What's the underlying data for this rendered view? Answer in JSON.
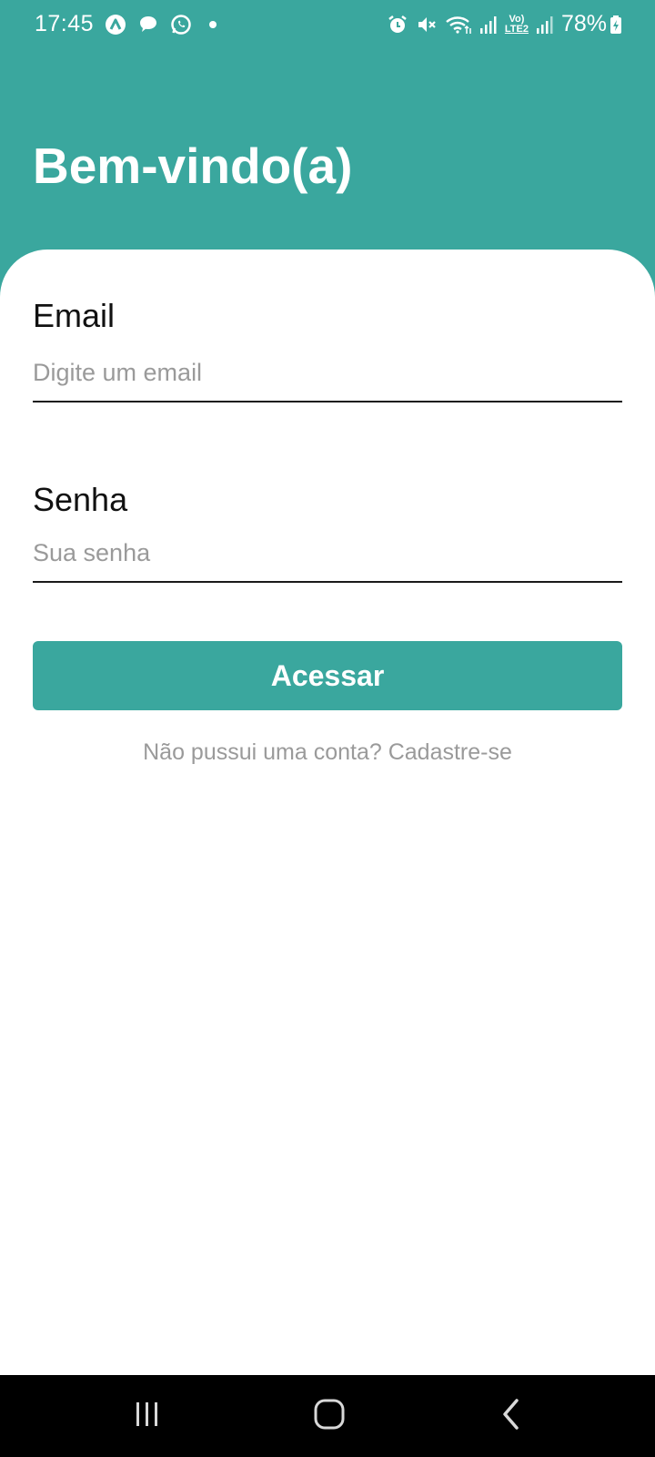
{
  "status_bar": {
    "time": "17:45",
    "left_icons": [
      "app-a-icon",
      "message-bubble-icon",
      "whatsapp-icon",
      "dot-icon"
    ],
    "right_icons": [
      "alarm-icon",
      "mute-icon",
      "wifi-icon",
      "signal-icon",
      "volte-lte2-icon",
      "signal-icon"
    ],
    "battery": "78%",
    "volte_label": "Vo)",
    "lte_label": "LTE2"
  },
  "header": {
    "title": "Bem-vindo(a)"
  },
  "form": {
    "email": {
      "label": "Email",
      "placeholder": "Digite um email",
      "value": ""
    },
    "password": {
      "label": "Senha",
      "placeholder": "Sua senha",
      "value": ""
    },
    "submit_label": "Acessar",
    "signup_text": "Não pussui uma conta? Cadastre-se"
  },
  "nav_bar": {
    "buttons": [
      "recents-icon",
      "home-icon",
      "back-icon"
    ]
  },
  "colors": {
    "accent": "#3aa79e",
    "background": "#ffffff",
    "nav_bar": "#000000",
    "placeholder": "#9a9a9a"
  }
}
